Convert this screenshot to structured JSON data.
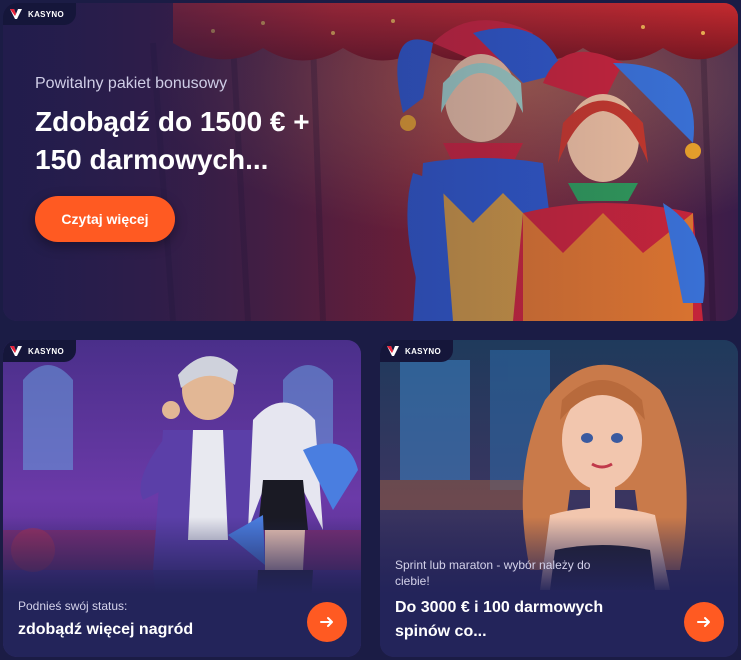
{
  "colors": {
    "accent": "#ff5a22",
    "background": "#1b1c45",
    "card": "#23245a"
  },
  "hero": {
    "badge": "KASYNO",
    "subtitle": "Powitalny pakiet bonusowy",
    "title": "Zdobądź do 1500 € + 150 darmowych...",
    "cta_label": "Czytaj więcej"
  },
  "promos": [
    {
      "badge": "KASYNO",
      "subtitle": "Podnieś swój status:",
      "title": "zdobądź więcej nagród",
      "icon": "arrow-right-icon"
    },
    {
      "badge": "KASYNO",
      "subtitle": "Sprint lub maraton - wybór należy do ciebie!",
      "title": "Do 3000 € i 100 darmowych spinów co...",
      "icon": "arrow-right-icon"
    }
  ]
}
